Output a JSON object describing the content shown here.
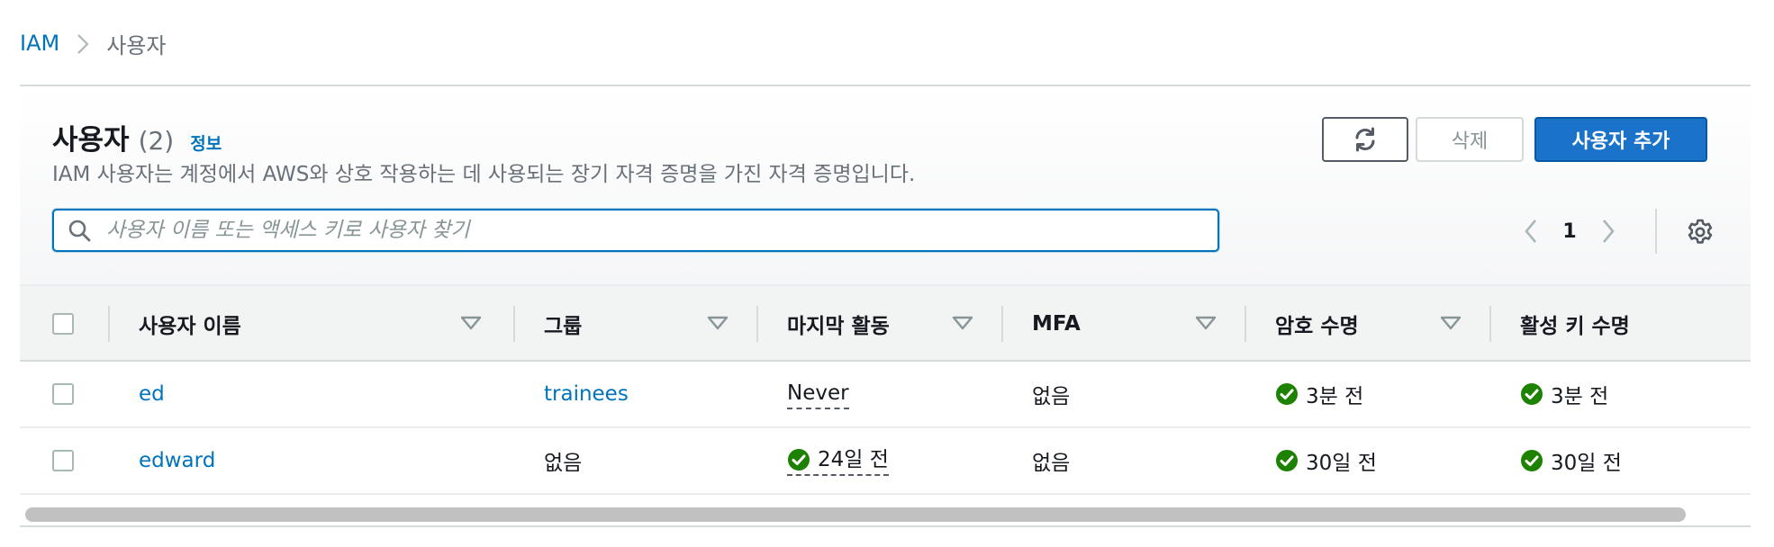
{
  "breadcrumb": {
    "root": "IAM",
    "current": "사용자"
  },
  "header": {
    "title": "사용자",
    "count": "(2)",
    "info": "정보",
    "description": "IAM 사용자는 계정에서 AWS와 상호 작용하는 데 사용되는 장기 자격 증명을 가진 자격 증명입니다."
  },
  "actions": {
    "refresh_icon": "refresh-icon",
    "delete_label": "삭제",
    "add_label": "사용자 추가"
  },
  "search": {
    "value": "",
    "placeholder": "사용자 이름 또는 액세스 키로 사용자 찾기"
  },
  "pagination": {
    "current_page": "1"
  },
  "table": {
    "columns": [
      "사용자 이름",
      "그룹",
      "마지막 활동",
      "MFA",
      "암호 수명",
      "활성 키 수명"
    ],
    "rows": [
      {
        "username": "ed",
        "group": "trainees",
        "last_activity": "Never",
        "mfa": "없음",
        "password_age": "3분 전",
        "key_age": "3분 전"
      },
      {
        "username": "edward",
        "group": "없음",
        "last_activity": "24일 전",
        "mfa": "없음",
        "password_age": "30일 전",
        "key_age": "30일 전"
      }
    ]
  },
  "colors": {
    "link": "#0073bb",
    "primary": "#1a73c9",
    "success": "#1d8102"
  }
}
